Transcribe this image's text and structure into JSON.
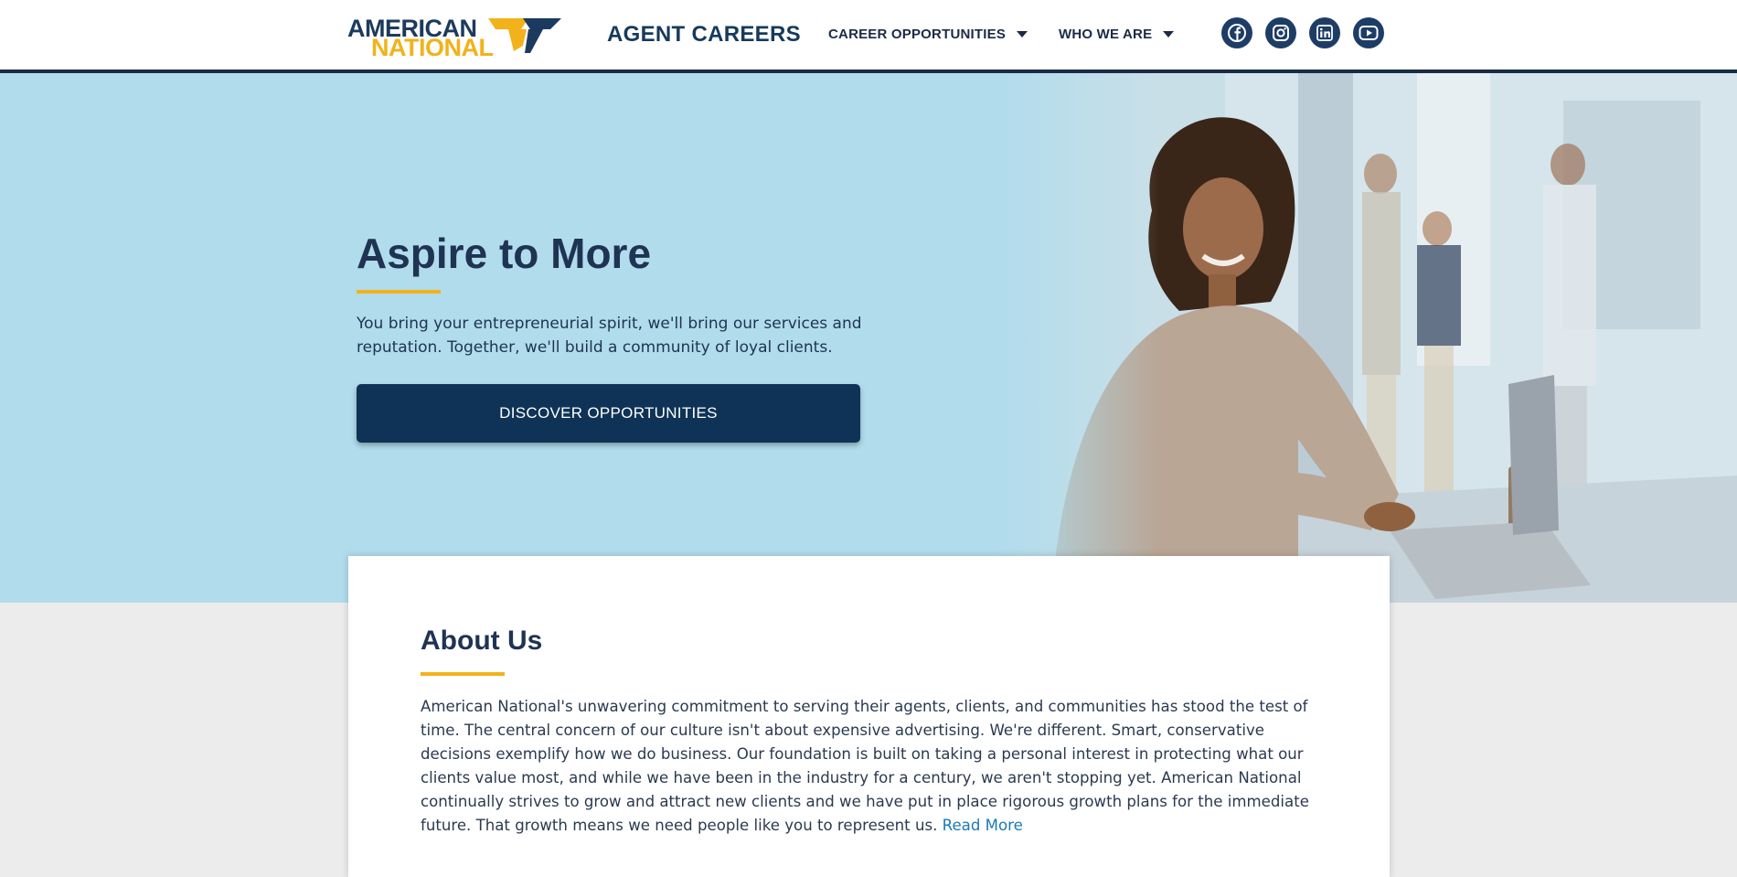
{
  "header": {
    "logo_line1": "AMERICAN",
    "logo_line2": "NATIONAL",
    "site_title": "AGENT CAREERS",
    "nav": [
      {
        "label": "CAREER OPPORTUNITIES"
      },
      {
        "label": "WHO WE ARE"
      }
    ],
    "social": [
      {
        "icon": "facebook-icon"
      },
      {
        "icon": "instagram-icon"
      },
      {
        "icon": "linkedin-icon"
      },
      {
        "icon": "youtube-icon"
      }
    ]
  },
  "hero": {
    "title": "Aspire to More",
    "text": "You bring your entrepreneurial spirit, we'll bring our services and reputation. Together, we'll build a community of loyal clients.",
    "cta_label": "DISCOVER OPPORTUNITIES"
  },
  "about": {
    "title": "About Us",
    "text": "American National's unwavering commitment to serving their agents, clients, and communities has stood the test of time. The central concern of our culture isn't about expensive advertising. We're different. Smart, conservative decisions exemplify how we do business. Our foundation is built on taking a personal interest in protecting what our clients value most, and while we have been in the industry for a century, we aren't stopping yet. American National continually strives to grow and attract new clients and we have put in place rigorous growth plans for the immediate future. That growth means we need people like you to represent us.",
    "read_more": "Read More"
  },
  "colors": {
    "navy": "#1b2b45",
    "brand_blue": "#0f3356",
    "gold": "#f2b21b",
    "hero_bg": "#b1dcec",
    "link": "#1a7ab8"
  }
}
